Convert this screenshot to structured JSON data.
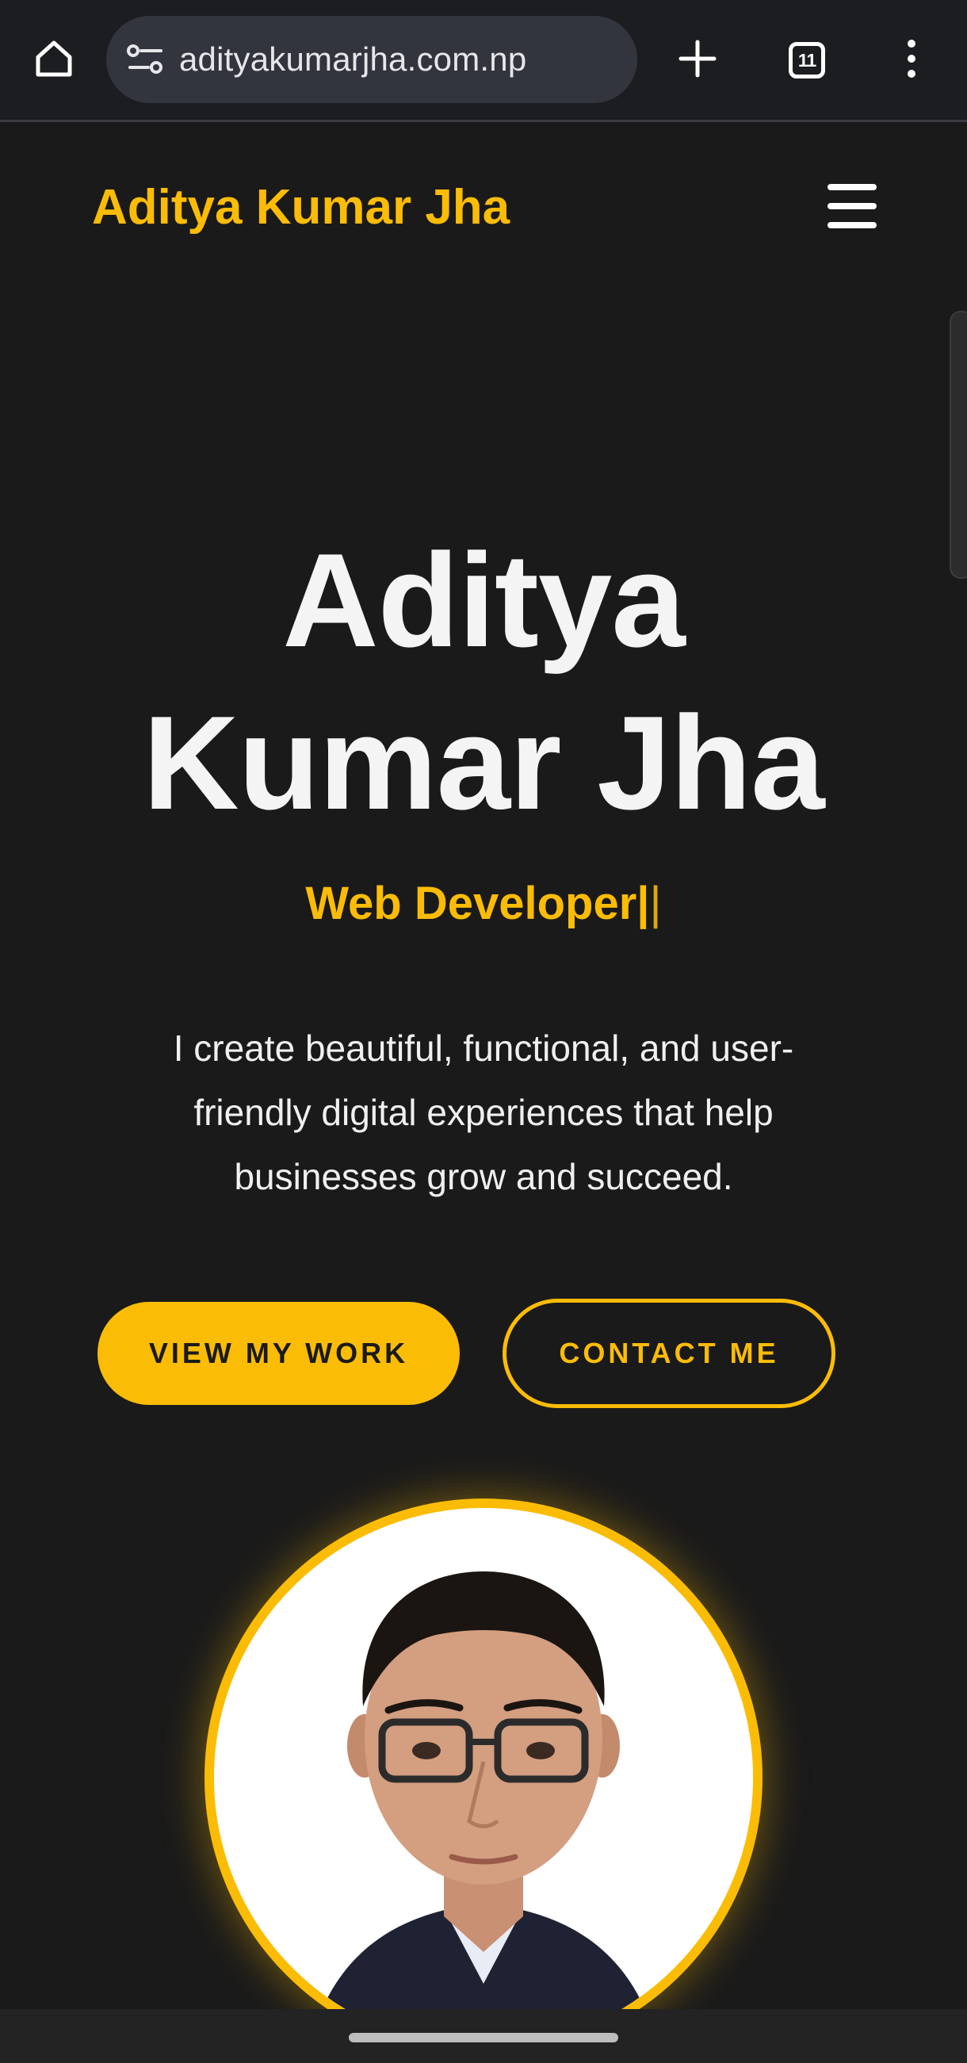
{
  "browser": {
    "url": "adityakumarjha.com.np",
    "tab_count": "11",
    "icons": {
      "home": "home-icon",
      "site_info": "tune-icon",
      "new_tab": "plus-icon",
      "tabs": "tab-switcher-icon",
      "menu": "more-vert-icon"
    }
  },
  "header": {
    "brand": "Aditya Kumar Jha",
    "menu_icon": "hamburger-menu-icon"
  },
  "hero": {
    "title_line1": "Aditya",
    "title_line2": "Kumar Jha",
    "role": "Web Developer|",
    "cursor": "|",
    "description_line1": "I create beautiful, functional, and user-",
    "description_line2": "friendly digital experiences that help",
    "description_line3": "businesses grow and succeed.",
    "primary_button": "VIEW MY WORK",
    "secondary_button": "CONTACT ME"
  },
  "colors": {
    "background": "#1a1a1a",
    "accent": "#fbbc05",
    "text": "#f4f4f4",
    "browser_bar": "#1c1d21",
    "url_box": "#32353d"
  }
}
